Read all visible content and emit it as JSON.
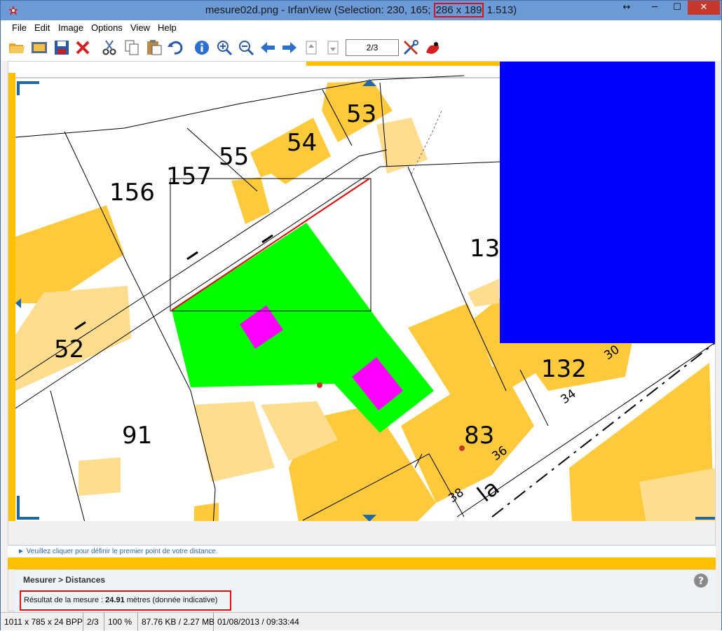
{
  "window": {
    "title_main": "mesure02d.png - IrfanView (Selection: 230, 165; ",
    "title_highlight": "286 x 189",
    "title_end": " 1.513)",
    "buttons": {
      "resize": "↔",
      "minimize": "─",
      "maximize": "☐",
      "close": "✕"
    }
  },
  "menu": [
    "File",
    "Edit",
    "Image",
    "Options",
    "View",
    "Help"
  ],
  "toolbar": {
    "page_field": "2/3",
    "icons": [
      "open-folder-icon",
      "slideshow-icon",
      "save-icon",
      "delete-icon",
      "cut-icon",
      "copy-icon",
      "paste-icon",
      "undo-icon",
      "info-icon",
      "zoom-in-icon",
      "zoom-out-icon",
      "previous-arrow-icon",
      "next-arrow-icon",
      "first-page-icon",
      "last-page-icon",
      "settings-tools-icon",
      "paint-icon"
    ]
  },
  "map": {
    "parcel_labels": [
      "53",
      "54",
      "55",
      "157",
      "156",
      "13",
      "52",
      "91",
      "132",
      "30",
      "34",
      "83",
      "36",
      "38",
      "la"
    ],
    "colors": {
      "building": "#ffc93c",
      "building_light": "#ffdd8f",
      "parcel": "#00ff00",
      "house": "#ff00ff",
      "overlay": "#0000ff",
      "measure_line": "#e00000"
    }
  },
  "hint": "► Veuillez cliquer pour définir le premier point de votre distance.",
  "measure": {
    "title": "Mesurer > Distances",
    "result_prefix": "Résultat de la mesure : ",
    "result_value": "24.91",
    "result_suffix": " mètres (donnée indicative)"
  },
  "status": [
    "1011 x 785 x 24 BPP",
    "2/3",
    "100 %",
    "87.76 KB / 2.27 MB",
    "01/08/2013 / 09:33:44"
  ]
}
